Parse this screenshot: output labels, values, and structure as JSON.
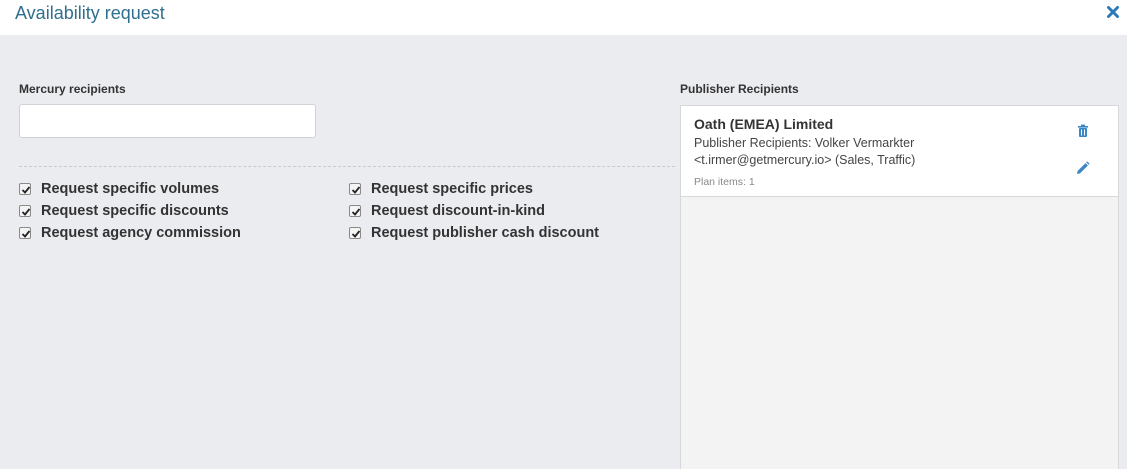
{
  "header": {
    "title": "Availability request",
    "close_icon": "close-icon"
  },
  "mercury": {
    "label": "Mercury recipients",
    "input_value": "",
    "input_placeholder": ""
  },
  "options": [
    {
      "label": "Request specific volumes",
      "checked": true
    },
    {
      "label": "Request specific discounts",
      "checked": true
    },
    {
      "label": "Request agency commission",
      "checked": true
    },
    {
      "label": "Request specific prices",
      "checked": true
    },
    {
      "label": "Request discount-in-kind",
      "checked": true
    },
    {
      "label": "Request publisher cash discount",
      "checked": true
    }
  ],
  "publisher": {
    "label": "Publisher Recipients",
    "cards": [
      {
        "name": "Oath (EMEA) Limited",
        "description": "Publisher Recipients: Volker Vermarkter <t.irmer@getmercury.io> (Sales, Traffic)",
        "plan_items": "Plan items: 1",
        "delete_icon": "trash-icon",
        "edit_icon": "pencil-icon"
      }
    ]
  },
  "colors": {
    "title": "#2f6f8f",
    "icon": "#3a87c8",
    "background": "#ebecf0"
  }
}
